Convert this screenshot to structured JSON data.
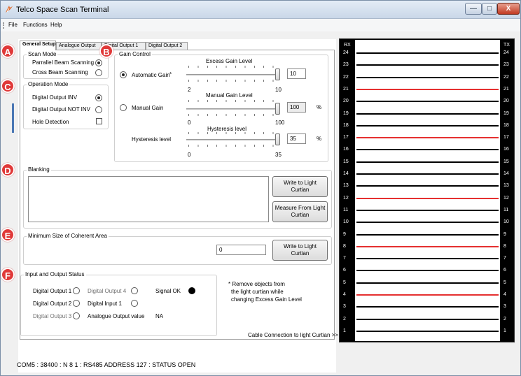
{
  "window": {
    "title": "Telco Space Scan Terminal",
    "controls": [
      "—",
      "□",
      "X"
    ]
  },
  "menu": [
    "File",
    "Functions",
    "Help"
  ],
  "tabs": [
    "General Setup",
    "Analogue Output",
    "Digital Output 1",
    "Digital Output 2"
  ],
  "markers": [
    "A",
    "B",
    "C",
    "D",
    "E",
    "F"
  ],
  "scan_mode": {
    "title": "Scan Mode",
    "options": [
      {
        "label": "Parrallel Beam Scanning",
        "selected": true
      },
      {
        "label": "Cross Beam Scanning",
        "selected": false
      }
    ]
  },
  "operation_mode": {
    "title": "Operation Mode",
    "options": [
      {
        "label": "Digital Output INV",
        "selected": true
      },
      {
        "label": "Digital Output NOT INV",
        "selected": false
      }
    ],
    "hole_detection": {
      "label": "Hole Detection",
      "checked": false
    }
  },
  "gain_control": {
    "title": "Gain Control",
    "excess": {
      "heading": "Excess Gain Level",
      "radio_label": "Automatic Gain",
      "asterisk": "*",
      "value": "10",
      "min": "2",
      "max": "10",
      "selected": true
    },
    "manual": {
      "heading": "Manual Gain Level",
      "radio_label": "Manual Gain",
      "value": "100",
      "unit": "%",
      "min": "0",
      "max": "100",
      "selected": false
    },
    "hysteresis": {
      "heading": "Hysteresis level",
      "label": "Hysteresis level",
      "value": "35",
      "unit": "%",
      "min": "0",
      "max": "35"
    }
  },
  "blanking": {
    "title": "Blanking",
    "write_button": "Write to Light Curtian",
    "measure_button": "Measure From Light Curtian"
  },
  "coherent": {
    "title": "Minimum Size of Coherent Area",
    "value": "0",
    "write_button": "Write to Light Curtian"
  },
  "io_status": {
    "title": "Input and Output Status",
    "items": {
      "do1": {
        "label": "Digital Output 1",
        "active": false,
        "dim": false
      },
      "do2": {
        "label": "Digital Output 2",
        "active": false,
        "dim": false
      },
      "do3": {
        "label": "Digital Output 3",
        "active": false,
        "dim": true
      },
      "do4": {
        "label": "Digital Output 4",
        "active": false,
        "dim": true
      },
      "di1": {
        "label": "Digital Input 1",
        "active": false,
        "dim": false
      },
      "signal": {
        "label": "Signal OK",
        "active": true,
        "dim": false
      }
    },
    "analogue_label": "Analogue Output value",
    "analogue_value": "NA",
    "note": [
      "* Remove objects from",
      "the light curtian while",
      "changing Excess Gain Level"
    ]
  },
  "cable_label": "Cable Connection to light Curtian >>",
  "status_bar": "COM5 : 38400 : N 8 1 : RS485 ADDRESS   127 : STATUS  OPEN",
  "light_curtain": {
    "rx_label": "RX",
    "tx_label": "TX",
    "beams": [
      {
        "n": "24",
        "interrupted": false
      },
      {
        "n": "23",
        "interrupted": false
      },
      {
        "n": "22",
        "interrupted": false
      },
      {
        "n": "21",
        "interrupted": true
      },
      {
        "n": "20",
        "interrupted": false
      },
      {
        "n": "19",
        "interrupted": false
      },
      {
        "n": "18",
        "interrupted": false
      },
      {
        "n": "17",
        "interrupted": true
      },
      {
        "n": "16",
        "interrupted": false
      },
      {
        "n": "15",
        "interrupted": false
      },
      {
        "n": "14",
        "interrupted": false
      },
      {
        "n": "13",
        "interrupted": false
      },
      {
        "n": "12",
        "interrupted": true
      },
      {
        "n": "11",
        "interrupted": false
      },
      {
        "n": "10",
        "interrupted": false
      },
      {
        "n": "9",
        "interrupted": false
      },
      {
        "n": "8",
        "interrupted": true
      },
      {
        "n": "7",
        "interrupted": false
      },
      {
        "n": "6",
        "interrupted": false
      },
      {
        "n": "5",
        "interrupted": false
      },
      {
        "n": "4",
        "interrupted": true
      },
      {
        "n": "3",
        "interrupted": false
      },
      {
        "n": "2",
        "interrupted": false
      },
      {
        "n": "1",
        "interrupted": false
      }
    ],
    "beam_color": "#000000",
    "interrupted_color": "#e53030"
  },
  "accent": "#e03838"
}
